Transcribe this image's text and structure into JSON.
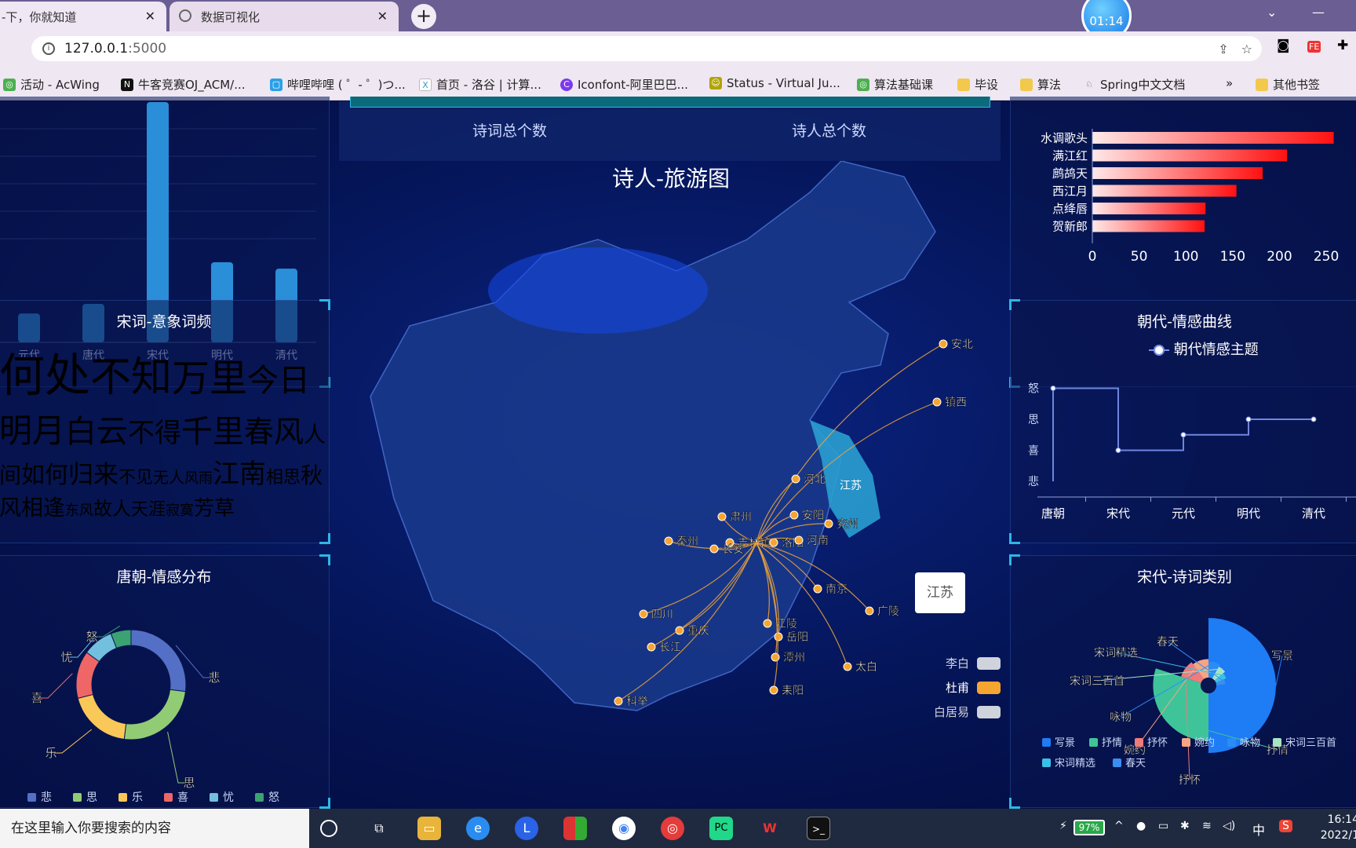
{
  "browser": {
    "tabs": [
      {
        "label": "-下，你就知道",
        "active": false
      },
      {
        "label": "数据可视化",
        "active": true
      }
    ],
    "timer": "01:14",
    "url_host": "127.0.0.1",
    "url_port": ":5000",
    "bookmarks": [
      "活动 - AcWing",
      "牛客竞赛OJ_ACM/...",
      "哔哩哔哩 ( ゜- ゜)つ...",
      "首页 - 洛谷 | 计算...",
      "Iconfont-阿里巴巴...",
      "Status - Virtual Ju...",
      "算法基础课",
      "毕设",
      "算法",
      "Spring中文文档",
      "»",
      "其他书签"
    ]
  },
  "stats": {
    "poems_total": "诗词总个数",
    "poets_total": "诗人总个数"
  },
  "dynasty_bar": {
    "chart_data": {
      "type": "bar",
      "categories": [
        "元代",
        "唐代",
        "宋代",
        "明代",
        "清代"
      ],
      "values": [
        18,
        24,
        150,
        50,
        46
      ]
    }
  },
  "wordcloud": {
    "title": "宋词-意象词频",
    "words": [
      "何处",
      "不知",
      "万里",
      "今日",
      "明月",
      "白云",
      "不得",
      "千里",
      "春风",
      "人间",
      "如何",
      "归来",
      "不见",
      "无人",
      "风雨",
      "江南",
      "相思",
      "秋风",
      "相逢",
      "东风",
      "故人",
      "天涯",
      "寂寞",
      "芳草"
    ]
  },
  "sentiment_pie": {
    "title": "唐朝-情感分布",
    "chart_data": {
      "type": "pie",
      "categories": [
        "悲",
        "思",
        "乐",
        "喜",
        "忧",
        "怒"
      ],
      "values": [
        27,
        25,
        19,
        14,
        9,
        6
      ],
      "colors": [
        "#5470c6",
        "#91cc75",
        "#fac858",
        "#ee6666",
        "#73c0de",
        "#3ba272"
      ]
    }
  },
  "map": {
    "title": "诗人-旅游图",
    "highlight": "江苏",
    "tooltip": "江苏",
    "places": [
      "安北",
      "镇西",
      "河北",
      "肃州",
      "安阳",
      "兖州",
      "秦州",
      "吉林镇",
      "洛阳",
      "河南",
      "长安",
      "南京",
      "广陵",
      "四川",
      "重庆",
      "江陵",
      "岳阳",
      "长江",
      "潭州",
      "太白",
      "耒阳",
      "科举"
    ],
    "legend": [
      {
        "label": "李白",
        "color": "#cfd3dc",
        "active": false
      },
      {
        "label": "杜甫",
        "color": "#f7a531",
        "active": true
      },
      {
        "label": "白居易",
        "color": "#cfd3dc",
        "active": false
      }
    ]
  },
  "cipai_bar": {
    "chart_data": {
      "type": "bar",
      "categories": [
        "水调歌头",
        "满江红",
        "鹧鸪天",
        "西江月",
        "点绛唇",
        "贺新郎"
      ],
      "values": [
        258,
        208,
        182,
        154,
        121,
        120
      ],
      "xticks": [
        "0",
        "50",
        "100",
        "150",
        "200",
        "250"
      ],
      "xlim": [
        0,
        260
      ]
    }
  },
  "emotion_line": {
    "title": "朝代-情感曲线",
    "legend": "朝代情感主题",
    "chart_data": {
      "type": "line",
      "step": true,
      "categories": [
        "唐朝",
        "宋代",
        "元代",
        "明代",
        "清代"
      ],
      "y_categories": [
        "悲",
        "喜",
        "思",
        "怒"
      ],
      "values": [
        3,
        1,
        1.5,
        2,
        2
      ]
    }
  },
  "song_types": {
    "title": "宋代-诗词类别",
    "chart_data": {
      "type": "pie",
      "rose": true,
      "categories": [
        "写景",
        "抒情",
        "抒怀",
        "婉约",
        "咏物",
        "宋词三百首",
        "宋词精选",
        "春天"
      ],
      "values": [
        120,
        95,
        40,
        35,
        30,
        25,
        20,
        15
      ],
      "colors": [
        "#1e7cf5",
        "#3fc49a",
        "#ef7b7b",
        "#f6a583",
        "#2b8cf5",
        "#a7e4c2",
        "#39c0e8",
        "#3b8ef0"
      ]
    }
  },
  "taskbar": {
    "search_placeholder": "在这里输入你要搜索的内容",
    "battery": "97%",
    "ime": "中",
    "time": "16:14",
    "date": "2022/1"
  }
}
